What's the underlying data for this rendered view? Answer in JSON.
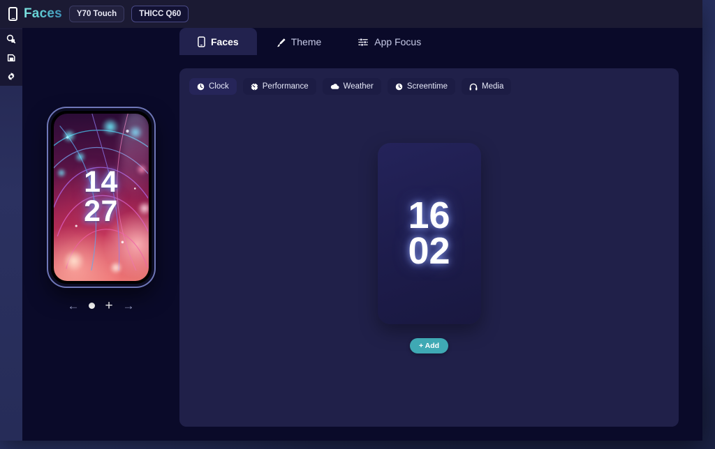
{
  "app": {
    "brand": "Faces",
    "brand_icon": "phone-icon"
  },
  "devices": [
    {
      "label": "Y70 Touch",
      "selected": false
    },
    {
      "label": "THICC Q60",
      "selected": true
    }
  ],
  "sidebar": {
    "items": [
      {
        "icon": "search-icon",
        "name": "sidebar-item-search"
      },
      {
        "icon": "save-icon",
        "name": "sidebar-item-save"
      },
      {
        "icon": "gear-icon",
        "name": "sidebar-item-settings"
      }
    ]
  },
  "tabs": [
    {
      "label": "Faces",
      "icon": "phone-icon",
      "active": true
    },
    {
      "label": "Theme",
      "icon": "brush-icon",
      "active": false
    },
    {
      "label": "App Focus",
      "icon": "sliders-icon",
      "active": false
    }
  ],
  "chips": [
    {
      "label": "Clock",
      "icon": "clock-icon",
      "active": true
    },
    {
      "label": "Performance",
      "icon": "gauge-icon",
      "active": false
    },
    {
      "label": "Weather",
      "icon": "cloud-icon",
      "active": false
    },
    {
      "label": "Screentime",
      "icon": "clock-icon",
      "active": false
    },
    {
      "label": "Media",
      "icon": "headphones-icon",
      "active": false
    }
  ],
  "preview": {
    "time_hours": "14",
    "time_minutes": "27",
    "carousel": {
      "prev": "←",
      "next": "→",
      "add": "+"
    }
  },
  "face_card": {
    "time_hours": "16",
    "time_minutes": "02",
    "add_label": "+ Add"
  },
  "colors": {
    "accent": "#3fa9b4",
    "brand_gradient_start": "#7fe3e0",
    "brand_gradient_end": "#3d8fb8",
    "window_bg": "#0a0a29",
    "panel_bg": "#202049",
    "header_bg": "#1b1a33"
  }
}
